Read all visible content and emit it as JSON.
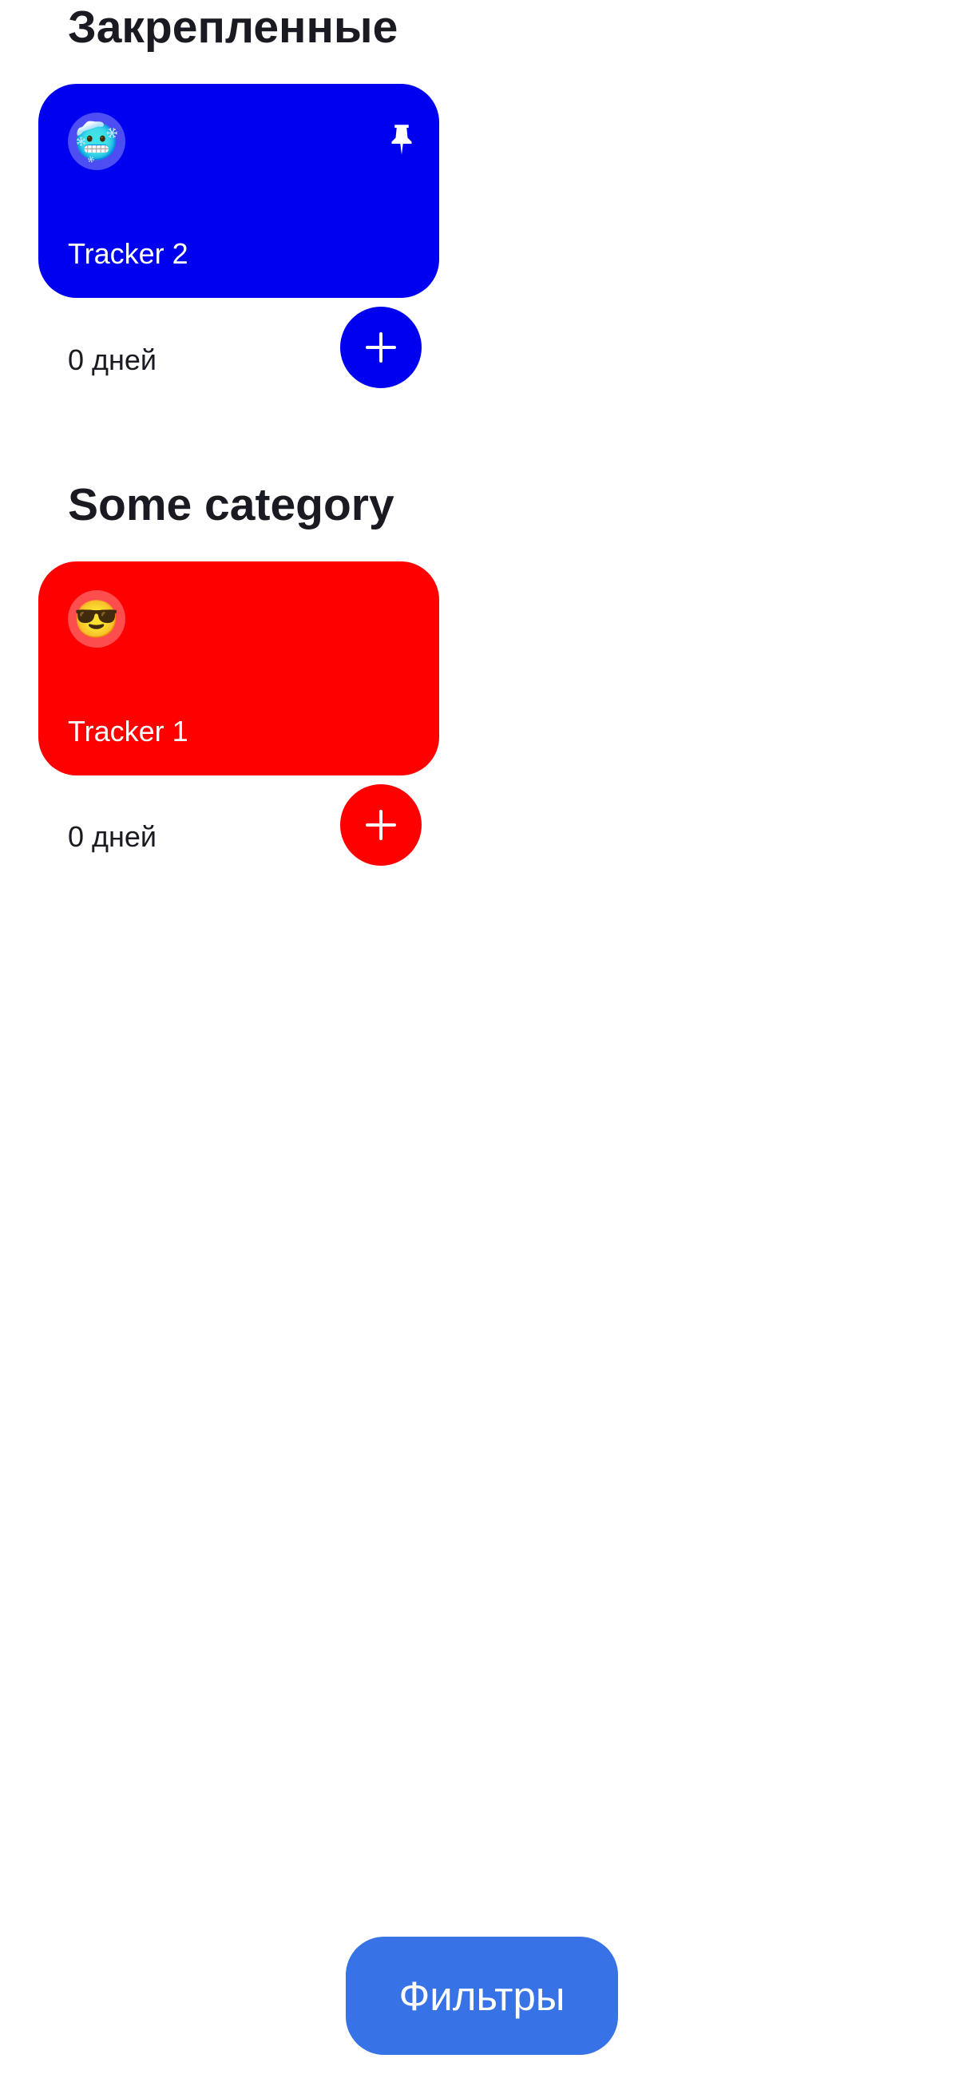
{
  "sections": [
    {
      "title": "Закрепленные",
      "trackers": [
        {
          "emoji": "🥶",
          "name": "Tracker 2",
          "days": "0 дней",
          "color": "#0000f0",
          "pinned": true,
          "icon": "pin-icon"
        }
      ]
    },
    {
      "title": "Some category",
      "trackers": [
        {
          "emoji": "😎",
          "name": "Tracker 1",
          "days": "0 дней",
          "color": "#fe0000",
          "pinned": false
        }
      ]
    }
  ],
  "filters_button": {
    "label": "Фильтры",
    "color": "#3772e7"
  },
  "icons": {
    "complete": "plus-icon",
    "pin": "pin-icon"
  }
}
